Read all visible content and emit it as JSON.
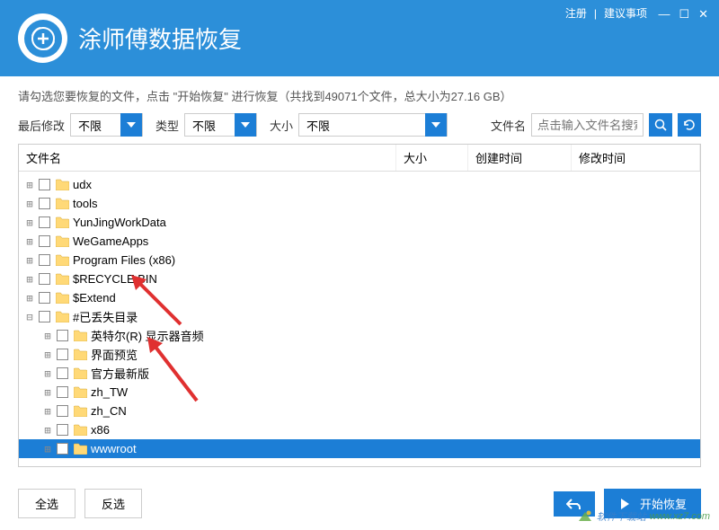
{
  "header": {
    "title": "涂师傅数据恢复",
    "register": "注册",
    "suggestion": "建议事项"
  },
  "instruction": "请勾选您要恢复的文件，点击 \"开始恢复\" 进行恢复（共找到49071个文件，总大小为27.16 GB）",
  "filters": {
    "modified_label": "最后修改",
    "modified_value": "不限",
    "type_label": "类型",
    "type_value": "不限",
    "size_label": "大小",
    "size_value": "不限",
    "search_label": "文件名",
    "search_placeholder": "点击输入文件名搜索"
  },
  "columns": {
    "name": "文件名",
    "size": "大小",
    "created": "创建时间",
    "modified": "修改时间"
  },
  "tree": [
    {
      "label": "udx",
      "indent": 1
    },
    {
      "label": "tools",
      "indent": 1
    },
    {
      "label": "YunJingWorkData",
      "indent": 1
    },
    {
      "label": "WeGameApps",
      "indent": 1
    },
    {
      "label": "Program Files (x86)",
      "indent": 1
    },
    {
      "label": "$RECYCLE.BIN",
      "indent": 1
    },
    {
      "label": "$Extend",
      "indent": 1
    },
    {
      "label": "#已丢失目录",
      "indent": 1,
      "expanded": true
    },
    {
      "label": "英特尔(R) 显示器音频",
      "indent": 2
    },
    {
      "label": "界面预览",
      "indent": 2
    },
    {
      "label": "官方最新版",
      "indent": 2
    },
    {
      "label": "zh_TW",
      "indent": 2
    },
    {
      "label": "zh_CN",
      "indent": 2
    },
    {
      "label": "x86",
      "indent": 2
    },
    {
      "label": "wwwroot",
      "indent": 2,
      "selected": true
    }
  ],
  "footer": {
    "select_all": "全选",
    "invert": "反选",
    "start": "开始恢复"
  },
  "watermark": {
    "text": "软件下载站",
    "url": "www.xz7.com"
  }
}
